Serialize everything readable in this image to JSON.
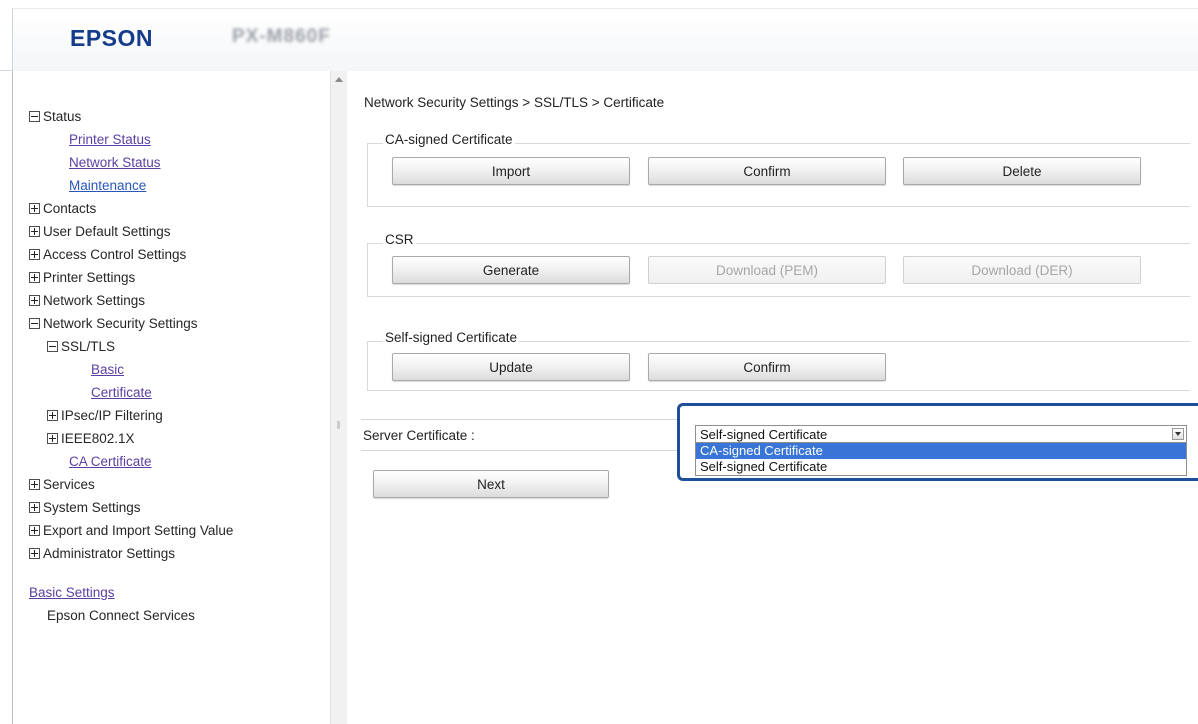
{
  "header": {
    "logo": "EPSON",
    "model": "PX-M860F"
  },
  "sidebar": {
    "items": [
      {
        "type": "group",
        "toggle": "minus",
        "label": "Status",
        "indent": 0
      },
      {
        "type": "link",
        "label": "Printer Status",
        "indent": 2
      },
      {
        "type": "link",
        "label": "Network Status",
        "indent": 2
      },
      {
        "type": "link-blue",
        "label": "Maintenance",
        "indent": 2
      },
      {
        "type": "group",
        "toggle": "plus",
        "label": "Contacts",
        "indent": 0
      },
      {
        "type": "group",
        "toggle": "plus",
        "label": "User Default Settings",
        "indent": 0
      },
      {
        "type": "group",
        "toggle": "plus",
        "label": "Access Control Settings",
        "indent": 0
      },
      {
        "type": "group",
        "toggle": "plus",
        "label": "Printer Settings",
        "indent": 0
      },
      {
        "type": "group",
        "toggle": "plus",
        "label": "Network Settings",
        "indent": 0
      },
      {
        "type": "group",
        "toggle": "minus",
        "label": "Network Security Settings",
        "indent": 0
      },
      {
        "type": "group",
        "toggle": "minus",
        "label": "SSL/TLS",
        "indent": 1
      },
      {
        "type": "link",
        "label": "Basic",
        "indent": 3
      },
      {
        "type": "link",
        "label": "Certificate",
        "indent": 3
      },
      {
        "type": "group",
        "toggle": "plus",
        "label": "IPsec/IP Filtering",
        "indent": 1
      },
      {
        "type": "group",
        "toggle": "plus",
        "label": "IEEE802.1X",
        "indent": 1
      },
      {
        "type": "link",
        "label": "CA Certificate",
        "indent": 2
      },
      {
        "type": "group",
        "toggle": "plus",
        "label": "Services",
        "indent": 0
      },
      {
        "type": "group",
        "toggle": "plus",
        "label": "System Settings",
        "indent": 0
      },
      {
        "type": "group",
        "toggle": "plus",
        "label": "Export and Import Setting Value",
        "indent": 0
      },
      {
        "type": "group",
        "toggle": "plus",
        "label": "Administrator Settings",
        "indent": 0
      },
      {
        "type": "spacer"
      },
      {
        "type": "link",
        "label": "Basic Settings",
        "indent": 0
      },
      {
        "type": "text",
        "label": "Epson Connect Services",
        "indent": 1
      }
    ]
  },
  "main": {
    "breadcrumb": "Network Security Settings > SSL/TLS > Certificate",
    "ca_signed": {
      "legend": "CA-signed Certificate",
      "import_label": "Import",
      "confirm_label": "Confirm",
      "delete_label": "Delete"
    },
    "csr": {
      "legend": "CSR",
      "generate_label": "Generate",
      "download_pem_label": "Download (PEM)",
      "download_der_label": "Download (DER)"
    },
    "self_signed": {
      "legend": "Self-signed Certificate",
      "update_label": "Update",
      "confirm_label": "Confirm"
    },
    "server_certificate": {
      "label": "Server Certificate :",
      "selected_value": "Self-signed Certificate",
      "options": [
        "CA-signed Certificate",
        "Self-signed Certificate"
      ],
      "highlighted_option": 0
    },
    "next_label": "Next"
  },
  "colors": {
    "logo": "#153b8c",
    "link": "#5a3fa3",
    "highlight_box": "#1e4f98",
    "selected_option": "#3875d7"
  }
}
